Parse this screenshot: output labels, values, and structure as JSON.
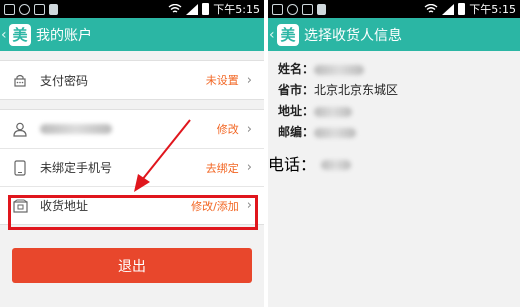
{
  "status_bar": {
    "time": "下午5:15"
  },
  "left": {
    "title": "我的账户",
    "logo": "美",
    "rows": [
      {
        "label": "支付密码",
        "value": "未设置",
        "icon": "lock-icon"
      },
      {
        "label": "",
        "value": "修改",
        "icon": "user-icon"
      },
      {
        "label": "未绑定手机号",
        "value": "去绑定",
        "icon": "tablet-icon"
      },
      {
        "label": "收货地址",
        "value": "修改/添加",
        "icon": "address-icon"
      }
    ],
    "logout": "退出"
  },
  "right": {
    "title": "选择收货人信息",
    "logo": "美",
    "name_key": "姓名：",
    "phone_key": "电话：",
    "province_key": "省市：",
    "province_value": "北京北京东城区",
    "address_key": "地址：",
    "postcode_key": "邮编："
  },
  "colors": {
    "teal": "#2bb6a4",
    "orange": "#f26522",
    "red": "#e0161d",
    "logout": "#e8472c"
  }
}
